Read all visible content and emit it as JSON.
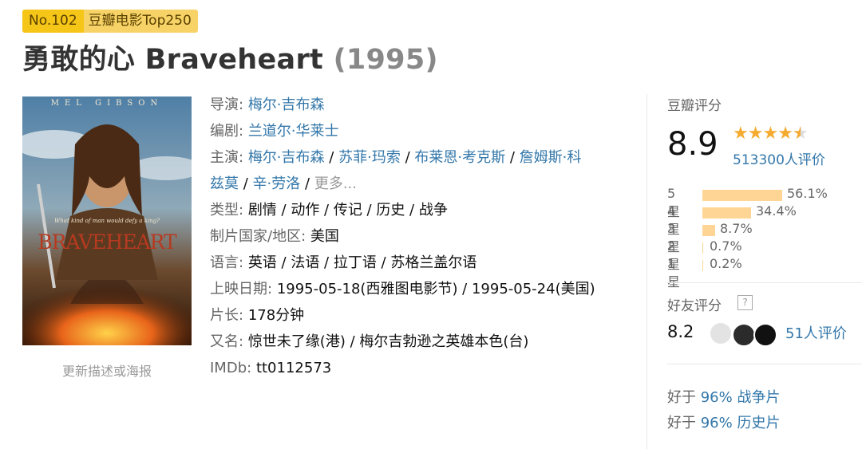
{
  "badge": {
    "rank": "No.102",
    "list": "豆瓣电影Top250"
  },
  "title": {
    "name": "勇敢的心 Braveheart",
    "year": "(1995)"
  },
  "poster": {
    "top_text": "MEL GIBSON",
    "tagline": "What kind of man would defy a king?",
    "logo": "BRAVEHEART",
    "update_link": "更新描述或海报"
  },
  "info": {
    "director_label": "导演:",
    "director": "梅尔·吉布森",
    "writer_label": "编剧:",
    "writer": "兰道尔·华莱士",
    "cast_label": "主演:",
    "cast": [
      "梅尔·吉布森",
      "苏菲·玛索",
      "布莱恩·考克斯",
      "詹姆斯·科",
      "兹莫",
      "辛·劳洛"
    ],
    "cast_more": "更多...",
    "genre_label": "类型:",
    "genre": "剧情 / 动作 / 传记 / 历史 / 战争",
    "country_label": "制片国家/地区:",
    "country": "美国",
    "language_label": "语言:",
    "language": "英语 / 法语 / 拉丁语 / 苏格兰盖尔语",
    "release_label": "上映日期:",
    "release": "1995-05-18(西雅图电影节) / 1995-05-24(美国)",
    "runtime_label": "片长:",
    "runtime": "178分钟",
    "aka_label": "又名:",
    "aka": "惊世未了缘(港) / 梅尔吉勃逊之英雄本色(台)",
    "imdb_label": "IMDb:",
    "imdb": "tt0112573"
  },
  "rating": {
    "label": "豆瓣评分",
    "score": "8.9",
    "stars": 4.5,
    "votes": "513300人评价",
    "distribution": [
      {
        "label": "5星",
        "pct": "56.1%",
        "value": 56.1
      },
      {
        "label": "4星",
        "pct": "34.4%",
        "value": 34.4
      },
      {
        "label": "3星",
        "pct": "8.7%",
        "value": 8.7
      },
      {
        "label": "2星",
        "pct": "0.7%",
        "value": 0.7
      },
      {
        "label": "1星",
        "pct": "0.2%",
        "value": 0.2
      }
    ],
    "friends_label": "好友评分",
    "friends_help": "?",
    "friends_score": "8.2",
    "friends_votes": "51人评价",
    "better_than": [
      {
        "prefix": "好于",
        "value": "96% 战争片"
      },
      {
        "prefix": "好于",
        "value": "96% 历史片"
      }
    ]
  },
  "colors": {
    "link": "#3377aa",
    "badge": "#f5c518",
    "bar": "#ffd596",
    "star": "#f5ab30"
  }
}
